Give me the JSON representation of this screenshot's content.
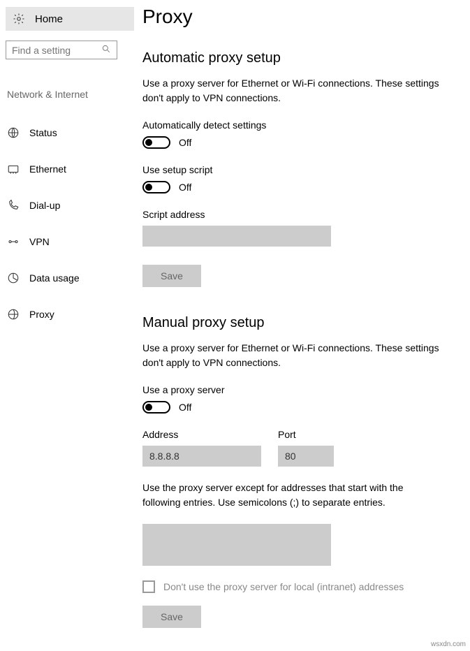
{
  "sidebar": {
    "home_label": "Home",
    "search_placeholder": "Find a setting",
    "section_label": "Network & Internet",
    "items": [
      {
        "label": "Status"
      },
      {
        "label": "Ethernet"
      },
      {
        "label": "Dial-up"
      },
      {
        "label": "VPN"
      },
      {
        "label": "Data usage"
      },
      {
        "label": "Proxy"
      }
    ]
  },
  "page": {
    "title": "Proxy",
    "auto": {
      "heading": "Automatic proxy setup",
      "description": "Use a proxy server for Ethernet or Wi-Fi connections. These settings don't apply to VPN connections.",
      "detect_label": "Automatically detect settings",
      "detect_state": "Off",
      "script_label": "Use setup script",
      "script_state": "Off",
      "script_addr_label": "Script address",
      "script_addr_value": "",
      "save_label": "Save"
    },
    "manual": {
      "heading": "Manual proxy setup",
      "description": "Use a proxy server for Ethernet or Wi-Fi connections. These settings don't apply to VPN connections.",
      "use_label": "Use a proxy server",
      "use_state": "Off",
      "address_label": "Address",
      "address_value": "8.8.8.8",
      "port_label": "Port",
      "port_value": "80",
      "except_text": "Use the proxy server except for addresses that start with the following entries. Use semicolons (;) to separate entries.",
      "except_value": "",
      "bypass_local_label": "Don't use the proxy server for local (intranet) addresses",
      "save_label": "Save"
    }
  },
  "watermark": "wsxdn.com"
}
